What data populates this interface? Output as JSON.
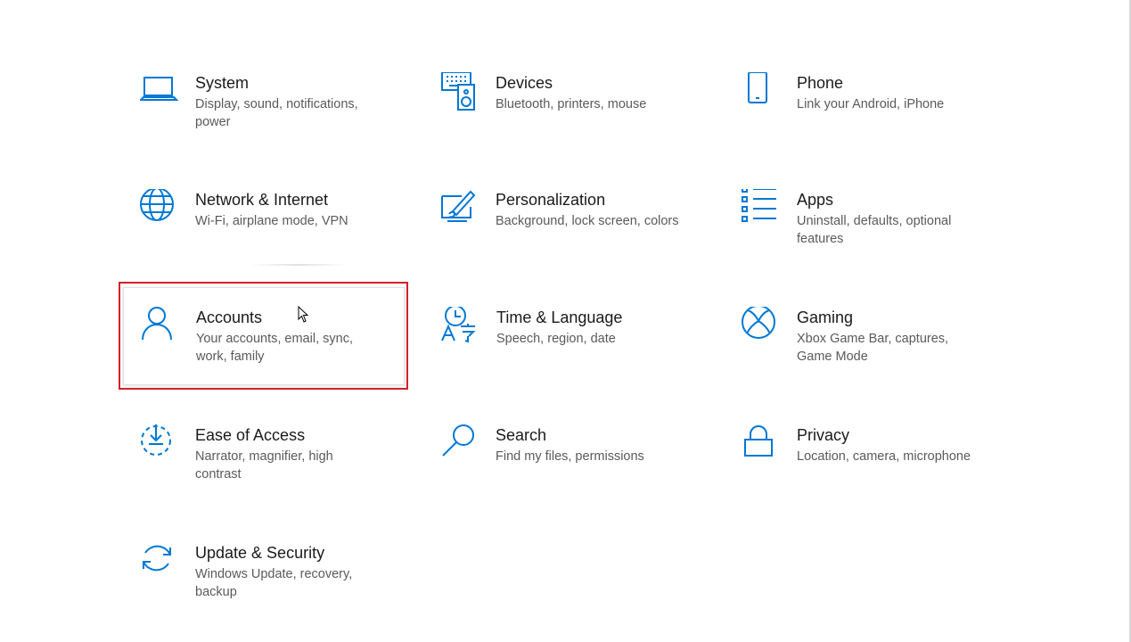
{
  "accent_color": "#0078d4",
  "highlight_color": "#d32029",
  "tiles": [
    {
      "title": "System",
      "desc": "Display, sound, notifications, power",
      "icon": "laptop-icon"
    },
    {
      "title": "Devices",
      "desc": "Bluetooth, printers, mouse",
      "icon": "keyboard-speaker-icon"
    },
    {
      "title": "Phone",
      "desc": "Link your Android, iPhone",
      "icon": "phone-icon"
    },
    {
      "title": "Network & Internet",
      "desc": "Wi-Fi, airplane mode, VPN",
      "icon": "globe-icon"
    },
    {
      "title": "Personalization",
      "desc": "Background, lock screen, colors",
      "icon": "paint-brush-icon"
    },
    {
      "title": "Apps",
      "desc": "Uninstall, defaults, optional features",
      "icon": "apps-list-icon"
    },
    {
      "title": "Accounts",
      "desc": "Your accounts, email, sync, work, family",
      "icon": "person-icon"
    },
    {
      "title": "Time & Language",
      "desc": "Speech, region, date",
      "icon": "time-language-icon"
    },
    {
      "title": "Gaming",
      "desc": "Xbox Game Bar, captures, Game Mode",
      "icon": "xbox-icon"
    },
    {
      "title": "Ease of Access",
      "desc": "Narrator, magnifier, high contrast",
      "icon": "ease-of-access-icon"
    },
    {
      "title": "Search",
      "desc": "Find my files, permissions",
      "icon": "search-icon"
    },
    {
      "title": "Privacy",
      "desc": "Location, camera, microphone",
      "icon": "lock-icon"
    },
    {
      "title": "Update & Security",
      "desc": "Windows Update, recovery, backup",
      "icon": "sync-icon"
    }
  ]
}
